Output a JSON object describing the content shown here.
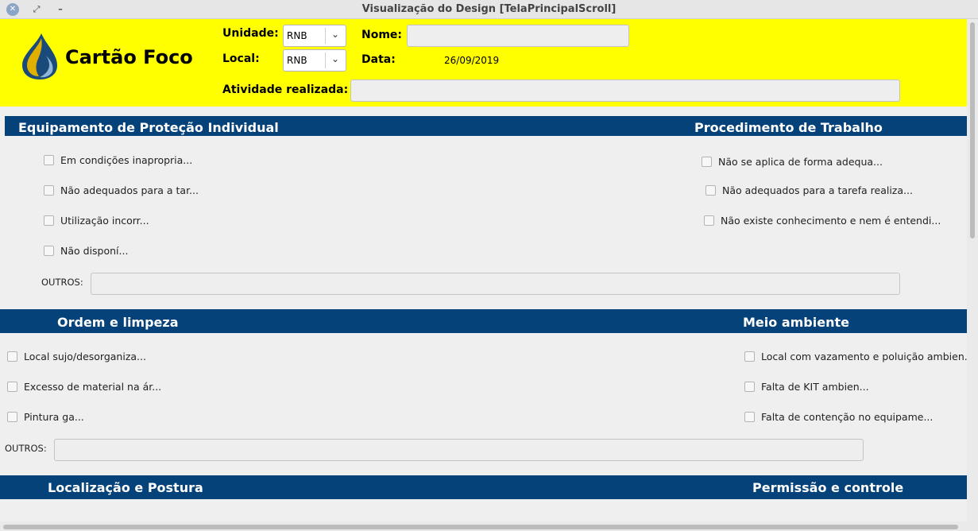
{
  "window": {
    "title": "Visualização do Design [TelaPrincipalScroll]",
    "close_glyph": "✕",
    "max_glyph": "⤢",
    "min_glyph": "–"
  },
  "header": {
    "brand": "Cartão Foco",
    "unidade_label": "Unidade:",
    "unidade_value": "RNB",
    "local_label": "Local:",
    "local_value": "RNB",
    "nome_label": "Nome:",
    "nome_value": "",
    "data_label": "Data:",
    "data_value": "26/09/2019",
    "atividade_label": "Atividade realizada:",
    "atividade_value": "",
    "accent_color": "#ffff00",
    "chevron": "⌄"
  },
  "sections": {
    "epi": {
      "title": "Equipamento de Proteção Individual",
      "items": [
        "Em condições inapropria...",
        "Não adequados para a tar...",
        "Utilização incorr...",
        "Não disponí..."
      ],
      "outros_label": "OUTROS:",
      "outros_value": ""
    },
    "procedimento": {
      "title": "Procedimento de Trabalho",
      "items": [
        "Não se aplica de forma adequa...",
        "Não adequados para a tarefa realiza...",
        "Não existe conhecimento e nem é entendi..."
      ]
    },
    "ordem": {
      "title": "Ordem e limpeza",
      "items": [
        "Local sujo/desorganiza...",
        "Excesso de material na ár...",
        "Pintura ga..."
      ],
      "outros_label": "OUTROS:",
      "outros_value": ""
    },
    "meio": {
      "title": "Meio ambiente",
      "items": [
        "Local com vazamento e poluição ambien...",
        "Falta de KIT ambien...",
        "Falta de contenção no equipame..."
      ]
    },
    "localizacao": {
      "title": "Localização e Postura"
    },
    "permissao": {
      "title": "Permissão e controle"
    }
  },
  "colors": {
    "section_bg": "#06427a",
    "header_bg": "#ffff00"
  }
}
